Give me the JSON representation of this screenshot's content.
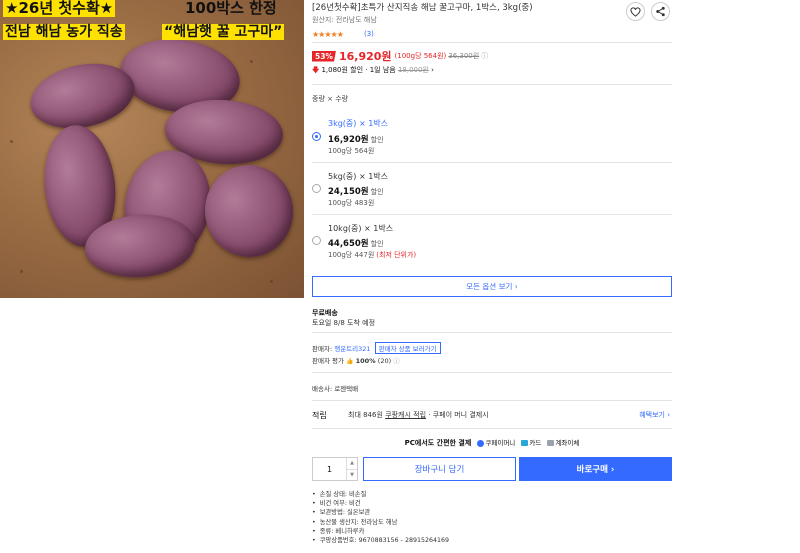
{
  "image": {
    "banner_top_left": "★26년 첫수확★",
    "banner_top_right": "100박스 한정",
    "banner_bottom_left": "전남 해남 농가 직송",
    "banner_bottom_right": "“해남햇 꿀 고구마”"
  },
  "product": {
    "title": "[26년첫수확]초특가 산지직송 해남 꿀고구마, 1박스, 3kg(중)",
    "origin": "원산지: 전라남도 해남",
    "stars": "★★★★★",
    "review_count": "(3)",
    "icons": [
      "heart-icon",
      "share-icon"
    ]
  },
  "price": {
    "discount_rate": "53%",
    "sale_price": "16,920원",
    "unit_price": "(100g당 564원)",
    "original_price": "36,300원",
    "info_icon": "ⓘ",
    "drop_text": "1,080원 할인 · 1일 남음",
    "drop_old": "18,000원",
    "drop_chevron": "›"
  },
  "options": {
    "label": "중량 × 수량",
    "items": [
      {
        "name": "3kg(중) × 1박스",
        "price": "16,920원",
        "discount": "할인",
        "per": "100g당 564원",
        "note": "",
        "selected": true
      },
      {
        "name": "5kg(중) × 1박스",
        "price": "24,150원",
        "discount": "할인",
        "per": "100g당 483원",
        "note": "",
        "selected": false
      },
      {
        "name": "10kg(중) × 1박스",
        "price": "44,650원",
        "discount": "할인",
        "per": "100g당 447원",
        "note": "(최저 단위가)",
        "selected": false
      }
    ],
    "see_all": "모든 옵션 보기 ›"
  },
  "shipping": {
    "title": "무료배송",
    "date": "토요일 8/8 도착 예정"
  },
  "seller": {
    "label": "판매자:",
    "name": "행운트리321",
    "link": "판매자 상품 보러가기",
    "rating_label": "판매자 평가",
    "thumb_icon": "👍",
    "rating": "100%",
    "rating_count": "(20)",
    "info_icon": "ⓘ",
    "carrier": "배송사: 로젠택배"
  },
  "points": {
    "label": "적립",
    "text_pre": "최대 846원",
    "text_link": "쿠팡캐시 적립",
    "text_post": "· 쿠페이 머니 결제시",
    "benefit": "혜택보기 ›"
  },
  "payment": {
    "label": "PC에서도 간편한 결제",
    "methods": [
      {
        "name": "쿠페이머니",
        "color": "#346aff"
      },
      {
        "name": "카드",
        "color": "#29a8d8"
      },
      {
        "name": "계좌이체",
        "color": "#9aa3ad"
      }
    ]
  },
  "purchase": {
    "quantity": "1",
    "cart_label": "장바구니 담기",
    "buy_label": "바로구매 ›"
  },
  "details": [
    "손질 상태: 비손질",
    "비건 여부: 비건",
    "보관방법: 실온보관",
    "농산물 생산지: 전라남도 해남",
    "종류: 베니하루카",
    "쿠팡상품번호: 9670883156 - 28915264169"
  ]
}
